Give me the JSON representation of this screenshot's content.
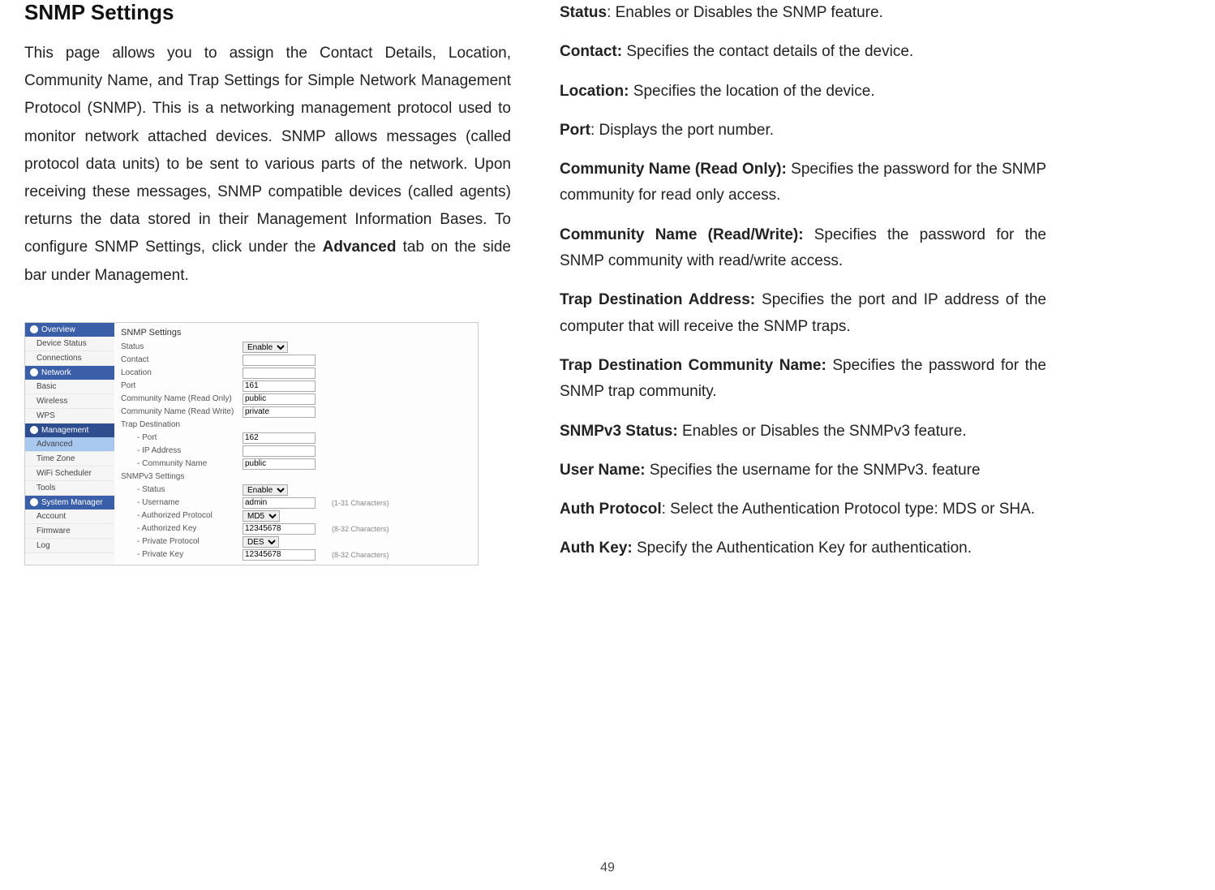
{
  "page_number": "49",
  "left": {
    "title": "SNMP Settings",
    "intro_part1": "This page allows you to assign the Contact Details, Location, Community Name, and Trap Settings for Simple Network Management Protocol (SNMP). This is a networking management protocol used to monitor network attached devices. SNMP allows messages (called protocol data units) to be sent to various parts of the network. Upon receiving these messages, SNMP compatible devices (called agents) returns the data stored in their Management Information Bases. To configure SNMP Settings, click under the ",
    "intro_bold": "Advanced",
    "intro_part2": " tab on the side bar under Management."
  },
  "screenshot": {
    "sidebar": {
      "overview": {
        "header": "Overview",
        "items": [
          "Device Status",
          "Connections"
        ]
      },
      "network": {
        "header": "Network",
        "items": [
          "Basic",
          "Wireless",
          "WPS"
        ]
      },
      "management": {
        "header": "Management",
        "items": [
          "Advanced",
          "Time Zone",
          "WiFi Scheduler",
          "Tools"
        ],
        "active": "Advanced"
      },
      "system": {
        "header": "System Manager",
        "items": [
          "Account",
          "Firmware",
          "Log"
        ]
      }
    },
    "panel": {
      "title": "SNMP Settings",
      "rows": {
        "status": {
          "label": "Status",
          "value": "Enable"
        },
        "contact": {
          "label": "Contact",
          "value": ""
        },
        "location": {
          "label": "Location",
          "value": ""
        },
        "port": {
          "label": "Port",
          "value": "161"
        },
        "comm_ro": {
          "label": "Community Name (Read Only)",
          "value": "public"
        },
        "comm_rw": {
          "label": "Community Name (Read Write)",
          "value": "private"
        },
        "trap_dest": {
          "label": "Trap Destination"
        },
        "trap_port": {
          "label": "- Port",
          "value": "162"
        },
        "trap_ip": {
          "label": "- IP Address",
          "value": ""
        },
        "trap_comm": {
          "label": "- Community Name",
          "value": "public"
        },
        "v3_settings": {
          "label": "SNMPv3 Settings"
        },
        "v3_status": {
          "label": "- Status",
          "value": "Enable"
        },
        "v3_user": {
          "label": "- Username",
          "value": "admin",
          "note": "(1-31 Characters)"
        },
        "v3_authp": {
          "label": "- Authorized Protocol",
          "value": "MD5"
        },
        "v3_authk": {
          "label": "- Authorized Key",
          "value": "12345678",
          "note": "(8-32 Characters)"
        },
        "v3_privp": {
          "label": "- Private Protocol",
          "value": "DES"
        },
        "v3_privk": {
          "label": "- Private Key",
          "value": "12345678",
          "note": "(8-32 Characters)"
        }
      }
    }
  },
  "definitions": [
    {
      "term": "Status",
      "sep": ": ",
      "text": "Enables or Disables the SNMP feature."
    },
    {
      "term": "Contact:",
      "sep": " ",
      "text": "Specifies the contact details of the device."
    },
    {
      "term": "Location:",
      "sep": " ",
      "text": "Specifies the location of the device."
    },
    {
      "term": "Port",
      "sep": ": ",
      "text": "Displays the port number."
    },
    {
      "term": "Community Name (Read Only):",
      "sep": " ",
      "text": "Specifies the password for the SNMP community for read only access."
    },
    {
      "term": "Community Name (Read/Write):",
      "sep": " ",
      "text": "Specifies the password for the SNMP community with read/write access."
    },
    {
      "term": "Trap Destination Address:",
      "sep": " ",
      "text": "Specifies the port and IP address of the computer that will receive the SNMP traps."
    },
    {
      "term": "Trap Destination Community Name:",
      "sep": " ",
      "text": "Specifies the password for the SNMP trap community."
    },
    {
      "term": "SNMPv3 Status:",
      "sep": " ",
      "text": "Enables or Disables the SNMPv3 feature."
    },
    {
      "term": "User Name:",
      "sep": " ",
      "text": "Specifies the username for the SNMPv3. feature"
    },
    {
      "term": "Auth Protocol",
      "sep": ": ",
      "text": "Select the Authentication Protocol type: MDS or SHA."
    },
    {
      "term": "Auth Key:",
      "sep": " ",
      "text": "Specify the Authentication Key for authentication."
    }
  ]
}
